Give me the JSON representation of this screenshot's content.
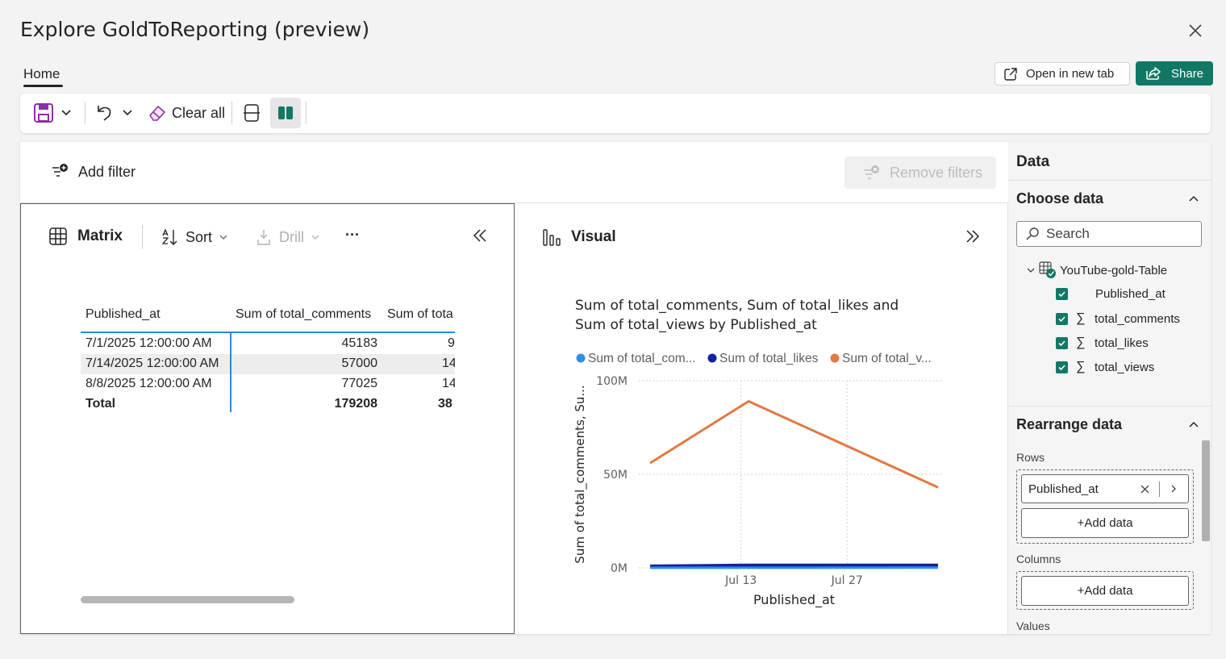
{
  "dialog": {
    "title": "Explore GoldToReporting (preview)",
    "tab_home": "Home",
    "open_new_tab": "Open in new tab",
    "share": "Share"
  },
  "toolbar": {
    "clear_all": "Clear all"
  },
  "filters": {
    "add_filter": "Add filter",
    "remove_filters": "Remove filters"
  },
  "matrix": {
    "title": "Matrix",
    "sort": "Sort",
    "drill": "Drill",
    "more": "···",
    "headers": [
      "Published_at",
      "Sum of total_comments",
      "Sum of tota"
    ],
    "rows": [
      [
        "7/1/2025 12:00:00 AM",
        "45183",
        "9"
      ],
      [
        "7/14/2025 12:00:00 AM",
        "57000",
        "14"
      ],
      [
        "8/8/2025 12:00:00 AM",
        "77025",
        "14"
      ]
    ],
    "total": [
      "Total",
      "179208",
      "38"
    ]
  },
  "visual": {
    "title": "Visual"
  },
  "chart_data": {
    "type": "line",
    "title": "Sum of total_comments, Sum of total_likes and Sum of total_views by Published_at",
    "title_line1": "Sum of total_comments, Sum of total_likes and",
    "title_line2": "Sum of total_views by Published_at",
    "xlabel": "Published_at",
    "ylabel": "Sum of total_comments, Su...",
    "x_ticks": [
      "Jul 13",
      "Jul 27"
    ],
    "y_ticks": [
      "100M",
      "50M",
      "0M"
    ],
    "ylim": [
      0,
      100000000
    ],
    "grid": true,
    "legend_position": "top",
    "x": [
      "2025-07-01",
      "2025-07-14",
      "2025-08-08"
    ],
    "series": [
      {
        "name": "Sum of total_com...",
        "color": "#2e8fe8",
        "values": [
          45183,
          57000,
          77025
        ]
      },
      {
        "name": "Sum of total_likes",
        "color": "#12239e",
        "values": [
          900000,
          1400000,
          1400000
        ]
      },
      {
        "name": "Sum of total_v...",
        "color": "#e07a43",
        "values": [
          56000000,
          89000000,
          43000000
        ]
      }
    ]
  },
  "data_pane": {
    "header": "Data",
    "choose_data": "Choose data",
    "search_placeholder": "Search",
    "table_name": "YouTube-gold-Table",
    "fields": [
      {
        "label": "Published_at",
        "sigma": false
      },
      {
        "label": "total_comments",
        "sigma": true
      },
      {
        "label": "total_likes",
        "sigma": true
      },
      {
        "label": "total_views",
        "sigma": true
      }
    ],
    "rearrange_data": "Rearrange data",
    "rows_label": "Rows",
    "rows_field": "Published_at",
    "add_data": "+Add data",
    "columns_label": "Columns",
    "values_label": "Values"
  },
  "colors": {
    "accent": "#117865",
    "matrix_border": "#5c5c5c"
  }
}
